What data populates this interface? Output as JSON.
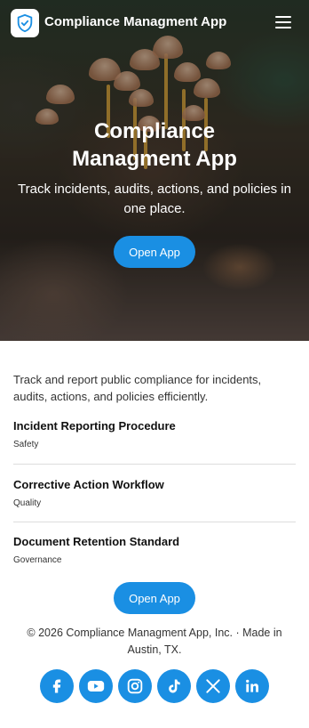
{
  "header": {
    "app_name": "Compliance Managment App",
    "logo_icon": "shield-check-icon",
    "menu_icon": "hamburger-menu-icon"
  },
  "hero": {
    "title": "Compliance Managment App",
    "subtitle": "Track incidents, audits, actions, and policies in one place.",
    "button_label": "Open App"
  },
  "content": {
    "intro": "Track and report public compliance for incidents, audits, actions, and policies efficiently.",
    "items": [
      {
        "title": "Incident Reporting Procedure",
        "category": "Safety"
      },
      {
        "title": "Corrective Action Workflow",
        "category": "Quality"
      },
      {
        "title": "Document Retention Standard",
        "category": "Governance"
      }
    ],
    "button_label": "Open App"
  },
  "footer": {
    "copyright": "© 2026 Compliance Managment App, Inc. · Made in Austin, TX.",
    "socials": [
      "facebook-icon",
      "youtube-icon",
      "instagram-icon",
      "tiktok-icon",
      "x-icon",
      "linkedin-icon"
    ]
  },
  "colors": {
    "accent": "#1a8fe3",
    "text": "#1c1c1c"
  }
}
